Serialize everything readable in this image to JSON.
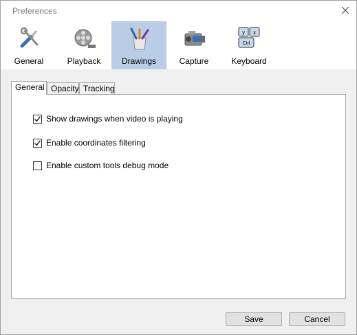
{
  "window": {
    "title": "Preferences"
  },
  "categories": [
    {
      "label": "General",
      "icon": "tools-icon"
    },
    {
      "label": "Playback",
      "icon": "film-reel-icon"
    },
    {
      "label": "Drawings",
      "icon": "brushes-icon",
      "selected": true
    },
    {
      "label": "Capture",
      "icon": "camera-icon"
    },
    {
      "label": "Keyboard",
      "icon": "keyboard-keys-icon"
    }
  ],
  "tabs": [
    {
      "label": "General",
      "active": true
    },
    {
      "label": "Opacity"
    },
    {
      "label": "Tracking"
    }
  ],
  "options": [
    {
      "label": "Show drawings when video is playing",
      "checked": true
    },
    {
      "label": "Enable coordinates filtering",
      "checked": true
    },
    {
      "label": "Enable custom tools debug mode",
      "checked": false
    }
  ],
  "keyboard_icon_keys": [
    "y",
    "x",
    "Ctrl"
  ],
  "buttons": {
    "save": "Save",
    "cancel": "Cancel"
  },
  "colors": {
    "selected_category": "#b9cde6",
    "window_bg": "#f0f0f0"
  }
}
